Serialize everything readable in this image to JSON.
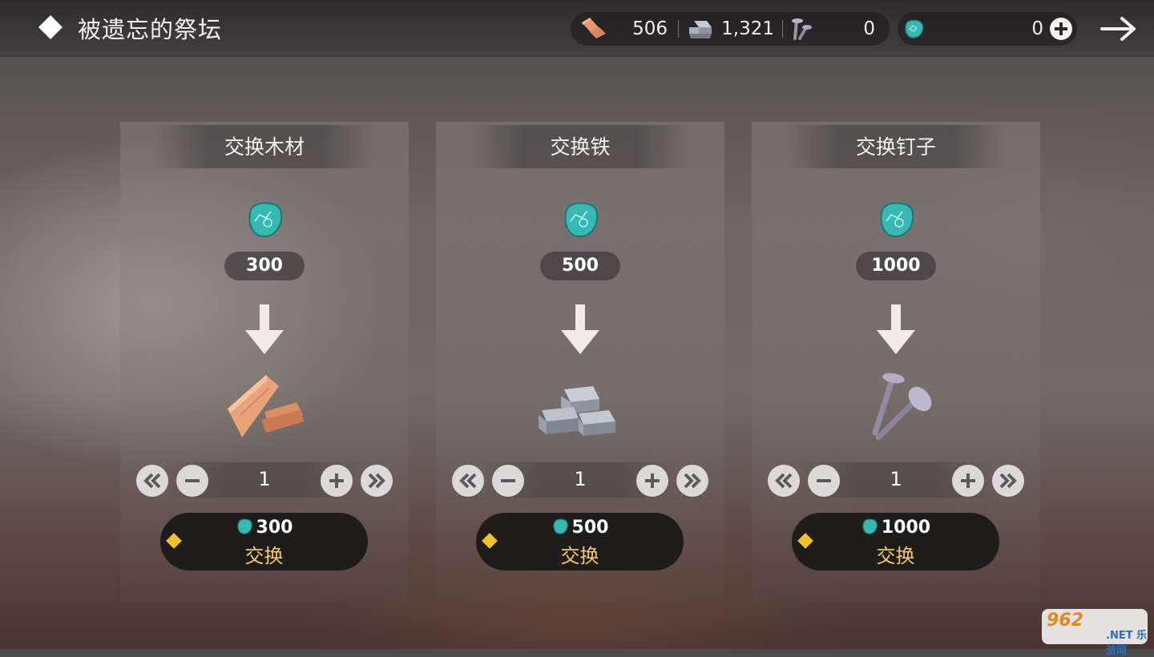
{
  "header": {
    "title": "被遗忘的祭坛",
    "resources": [
      {
        "name": "wood",
        "icon": "wood-planks-icon",
        "value": "506"
      },
      {
        "name": "iron",
        "icon": "iron-ingot-icon",
        "value": "1,321"
      },
      {
        "name": "nails",
        "icon": "nails-icon",
        "value": "0"
      }
    ],
    "gem": {
      "icon": "teal-gem-icon",
      "value": "0"
    },
    "add_icon": "plus-icon",
    "next_icon": "arrow-right-icon"
  },
  "panels": [
    {
      "title": "交换木材",
      "cost": "300",
      "item_icon": "wood-planks-icon",
      "quantity": "1",
      "button_price": "300",
      "button_label": "交换"
    },
    {
      "title": "交换铁",
      "cost": "500",
      "item_icon": "iron-ingot-icon",
      "quantity": "1",
      "button_price": "500",
      "button_label": "交换"
    },
    {
      "title": "交换钉子",
      "cost": "1000",
      "item_icon": "nails-icon",
      "quantity": "1",
      "button_price": "1000",
      "button_label": "交换"
    }
  ],
  "watermark": {
    "line1": "962",
    "line2": ".NET 乐游网"
  },
  "colors": {
    "gem": "#38b7b3",
    "button_label": "#f2c878",
    "diamond": "#f2c12e"
  }
}
